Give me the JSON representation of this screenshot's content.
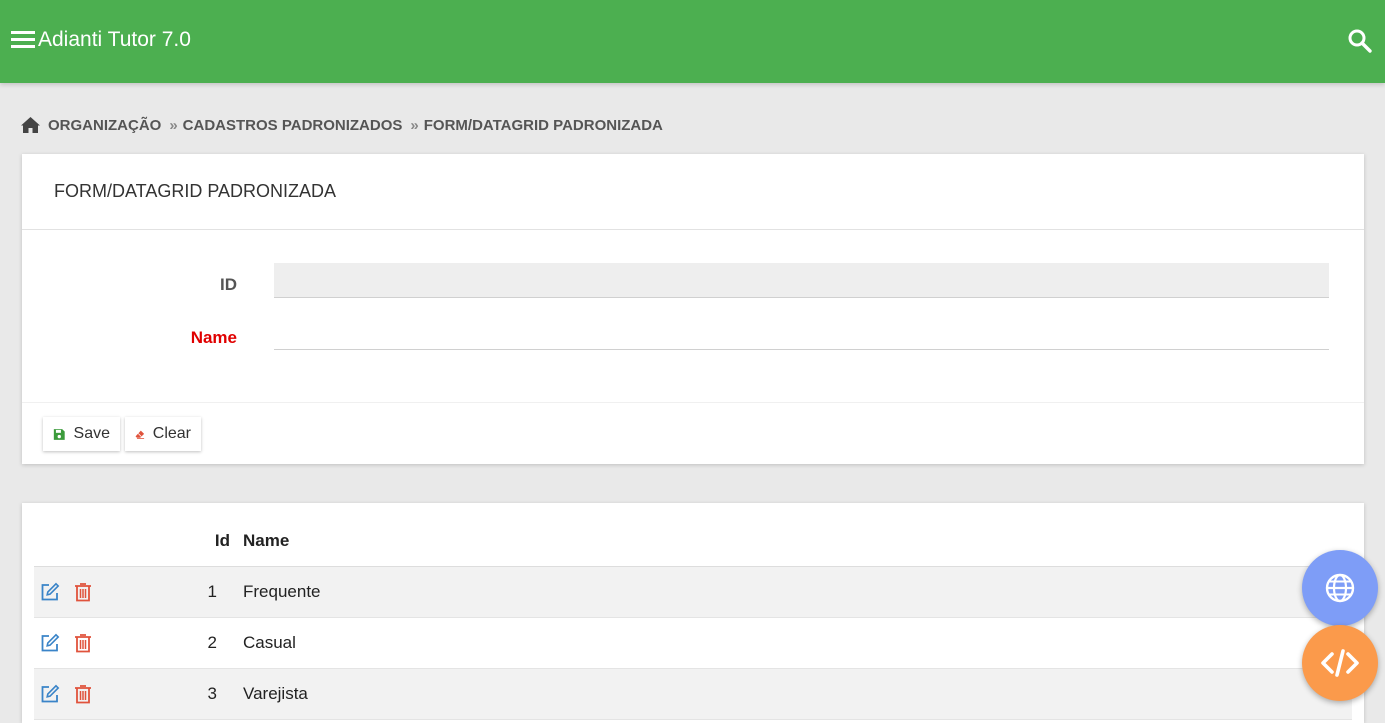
{
  "header": {
    "app_title": "Adianti Tutor 7.0",
    "menu_icon": "hamburger-icon",
    "search_icon": "search-icon",
    "bg_color": "#4caf50"
  },
  "breadcrumb": {
    "home_icon": "home-icon",
    "items": [
      "ORGANIZAÇÃO",
      "CADASTROS PADRONIZADOS",
      "FORM/DATAGRID PADRONIZADA"
    ],
    "separator": "»"
  },
  "form": {
    "title": "FORM/DATAGRID PADRONIZADA",
    "fields": [
      {
        "label": "ID",
        "value": "",
        "readonly": true,
        "required": false
      },
      {
        "label": "Name",
        "value": "",
        "readonly": false,
        "required": true
      }
    ],
    "buttons": {
      "save_label": "Save",
      "save_icon": "floppy-disk-icon",
      "clear_label": "Clear",
      "clear_icon": "eraser-icon"
    }
  },
  "datagrid": {
    "columns": [
      "Id",
      "Name"
    ],
    "row_actions": [
      "edit-icon",
      "trash-icon"
    ],
    "rows": [
      {
        "id": "1",
        "name": "Frequente"
      },
      {
        "id": "2",
        "name": "Casual"
      },
      {
        "id": "3",
        "name": "Varejista"
      }
    ]
  },
  "floating_buttons": [
    {
      "icon": "globe-icon",
      "color": "#7e9df7"
    },
    {
      "icon": "code-icon",
      "color": "#fb9a4b"
    }
  ],
  "colors": {
    "required_label": "#e00000",
    "edit_icon": "#3a84c8",
    "delete_icon": "#e0533c"
  }
}
